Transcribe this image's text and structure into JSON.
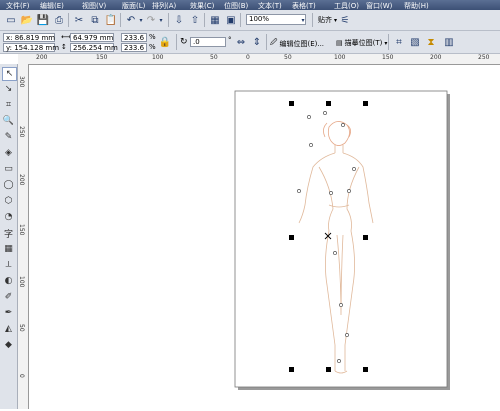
{
  "menu": [
    "文件(F)",
    "编辑(E)",
    "视图(V)",
    "版面(L)",
    "排列(A)",
    "效果(C)",
    "位图(B)",
    "文本(T)",
    "表格(T)",
    "工具(O)",
    "窗口(W)",
    "帮助(H)"
  ],
  "standard_toolbar": {
    "zoom_value": "100%",
    "snap_label": "贴齐"
  },
  "property_bar": {
    "x": "x: 86.819 mm",
    "y": "y: 154.128 mm",
    "width": "64.979 mm",
    "height": "256.254 mm",
    "scale_w": "233.6",
    "scale_h": "233.6",
    "pct": "%",
    "rotation": ".0",
    "rotation_unit": "°",
    "edit_bitmap": "编辑位图(E)...",
    "trace_bitmap": "描摹位图(T)"
  },
  "ruler_top_labels": [
    "200",
    "150",
    "100",
    "50",
    "0",
    "50",
    "100",
    "150",
    "200",
    "250"
  ],
  "ruler_left_labels": [
    "300",
    "250",
    "200",
    "150",
    "100",
    "50",
    "0"
  ]
}
